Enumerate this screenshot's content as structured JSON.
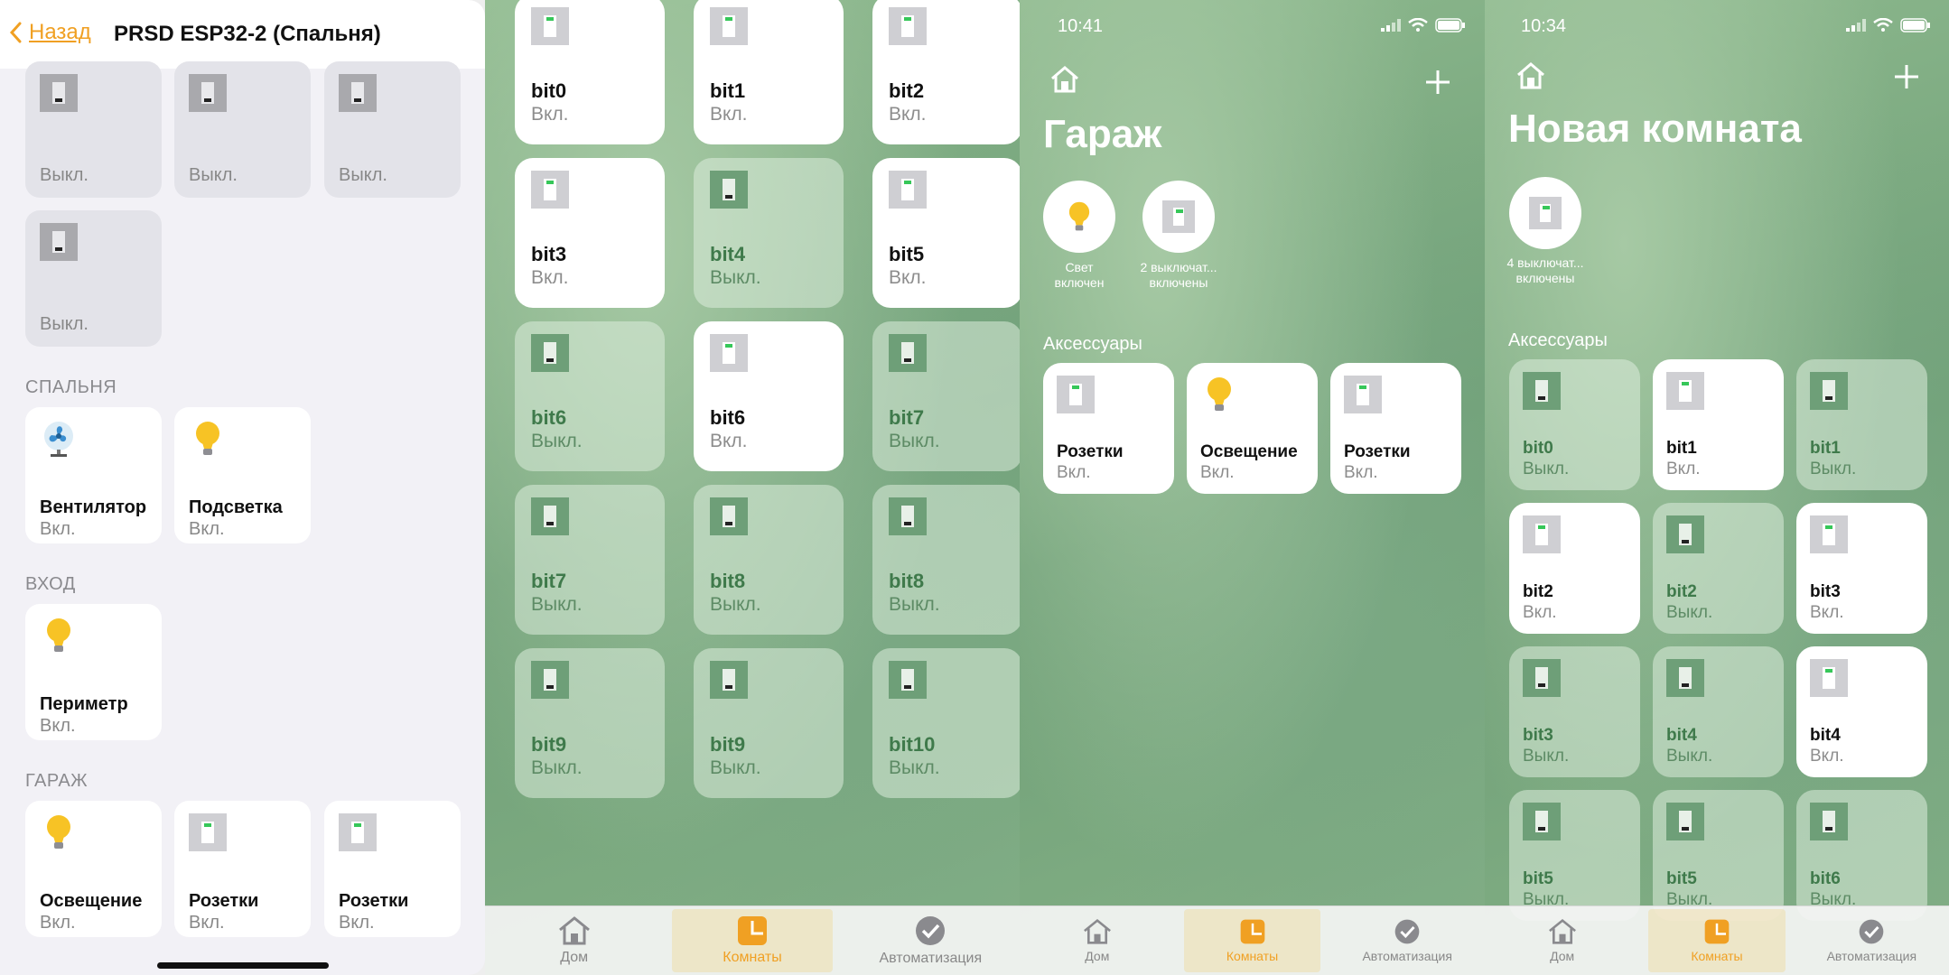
{
  "panel1": {
    "back_label": "Назад",
    "title": "PRSD ESP32-2 (Спальня)",
    "top_tiles": [
      {
        "status": "Выкл."
      },
      {
        "status": "Выкл."
      },
      {
        "status": "Выкл."
      },
      {
        "status": "Выкл."
      }
    ],
    "sections": [
      {
        "header": "СПАЛЬНЯ",
        "tiles": [
          {
            "name": "Вентилятор",
            "status": "Вкл.",
            "icon": "fan-icon"
          },
          {
            "name": "Подсветка",
            "status": "Вкл.",
            "icon": "bulb-icon"
          }
        ]
      },
      {
        "header": "ВХОД",
        "tiles": [
          {
            "name": "Периметр",
            "status": "Вкл.",
            "icon": "bulb-icon"
          }
        ]
      },
      {
        "header": "ГАРАЖ",
        "tiles": [
          {
            "name": "Освещение",
            "status": "Вкл.",
            "icon": "bulb-icon"
          },
          {
            "name": "Розетки",
            "status": "Вкл.",
            "icon": "switch-icon"
          },
          {
            "name": "Розетки",
            "status": "Вкл.",
            "icon": "switch-icon"
          }
        ]
      }
    ]
  },
  "panel2": {
    "tiles": [
      {
        "name": "bit0",
        "status": "Вкл.",
        "on": true
      },
      {
        "name": "bit1",
        "status": "Вкл.",
        "on": true
      },
      {
        "name": "bit2",
        "status": "Вкл.",
        "on": true
      },
      {
        "name": "bit3",
        "status": "Вкл.",
        "on": true
      },
      {
        "name": "bit4",
        "status": "Выкл.",
        "on": false
      },
      {
        "name": "bit5",
        "status": "Вкл.",
        "on": true
      },
      {
        "name": "bit6",
        "status": "Выкл.",
        "on": false
      },
      {
        "name": "bit6",
        "status": "Вкл.",
        "on": true
      },
      {
        "name": "bit7",
        "status": "Выкл.",
        "on": false
      },
      {
        "name": "bit7",
        "status": "Выкл.",
        "on": false
      },
      {
        "name": "bit8",
        "status": "Выкл.",
        "on": false
      },
      {
        "name": "bit8",
        "status": "Выкл.",
        "on": false
      },
      {
        "name": "bit9",
        "status": "Выкл.",
        "on": false
      },
      {
        "name": "bit9",
        "status": "Выкл.",
        "on": false
      },
      {
        "name": "bit10",
        "status": "Выкл.",
        "on": false
      }
    ],
    "tabs": [
      {
        "label": "Дом",
        "icon": "house-icon"
      },
      {
        "label": "Комнаты",
        "icon": "rooms-icon"
      },
      {
        "label": "Автоматизация",
        "icon": "automation-icon"
      }
    ]
  },
  "panel3": {
    "time": "10:41",
    "title": "Гараж",
    "status_circles": [
      {
        "label": "Свет\nвключен",
        "icon": "bulb-icon"
      },
      {
        "label": "2 выключат...\nвключены",
        "icon": "switch-icon"
      }
    ],
    "section_header": "Аксессуары",
    "tiles": [
      {
        "name": "Розетки",
        "status": "Вкл.",
        "icon": "switch-icon"
      },
      {
        "name": "Освещение",
        "status": "Вкл.",
        "icon": "bulb-icon"
      },
      {
        "name": "Розетки",
        "status": "Вкл.",
        "icon": "switch-icon"
      }
    ],
    "tabs": [
      {
        "label": "Дом"
      },
      {
        "label": "Комнаты"
      },
      {
        "label": "Автоматизация"
      }
    ]
  },
  "panel4": {
    "time": "10:34",
    "title": "Новая комната",
    "status_circles": [
      {
        "label": "4 выключат...\nвключены",
        "icon": "switch-icon"
      }
    ],
    "section_header": "Аксессуары",
    "tiles": [
      {
        "name": "bit0",
        "status": "Выкл.",
        "on": false
      },
      {
        "name": "bit1",
        "status": "Вкл.",
        "on": true
      },
      {
        "name": "bit1",
        "status": "Выкл.",
        "on": false
      },
      {
        "name": "bit2",
        "status": "Вкл.",
        "on": true
      },
      {
        "name": "bit2",
        "status": "Выкл.",
        "on": false
      },
      {
        "name": "bit3",
        "status": "Вкл.",
        "on": true
      },
      {
        "name": "bit3",
        "status": "Выкл.",
        "on": false
      },
      {
        "name": "bit4",
        "status": "Выкл.",
        "on": false
      },
      {
        "name": "bit4",
        "status": "Вкл.",
        "on": true
      },
      {
        "name": "bit5",
        "status": "Выкл.",
        "on": false
      },
      {
        "name": "bit5",
        "status": "Выкл.",
        "on": false
      },
      {
        "name": "bit6",
        "status": "Выкл.",
        "on": false
      }
    ],
    "tabs": [
      {
        "label": "Дом"
      },
      {
        "label": "Комнаты"
      },
      {
        "label": "Автоматизация"
      }
    ]
  },
  "colors": {
    "accent": "#f0a023",
    "on_led": "#36c759",
    "bulb": "#f7c325"
  }
}
